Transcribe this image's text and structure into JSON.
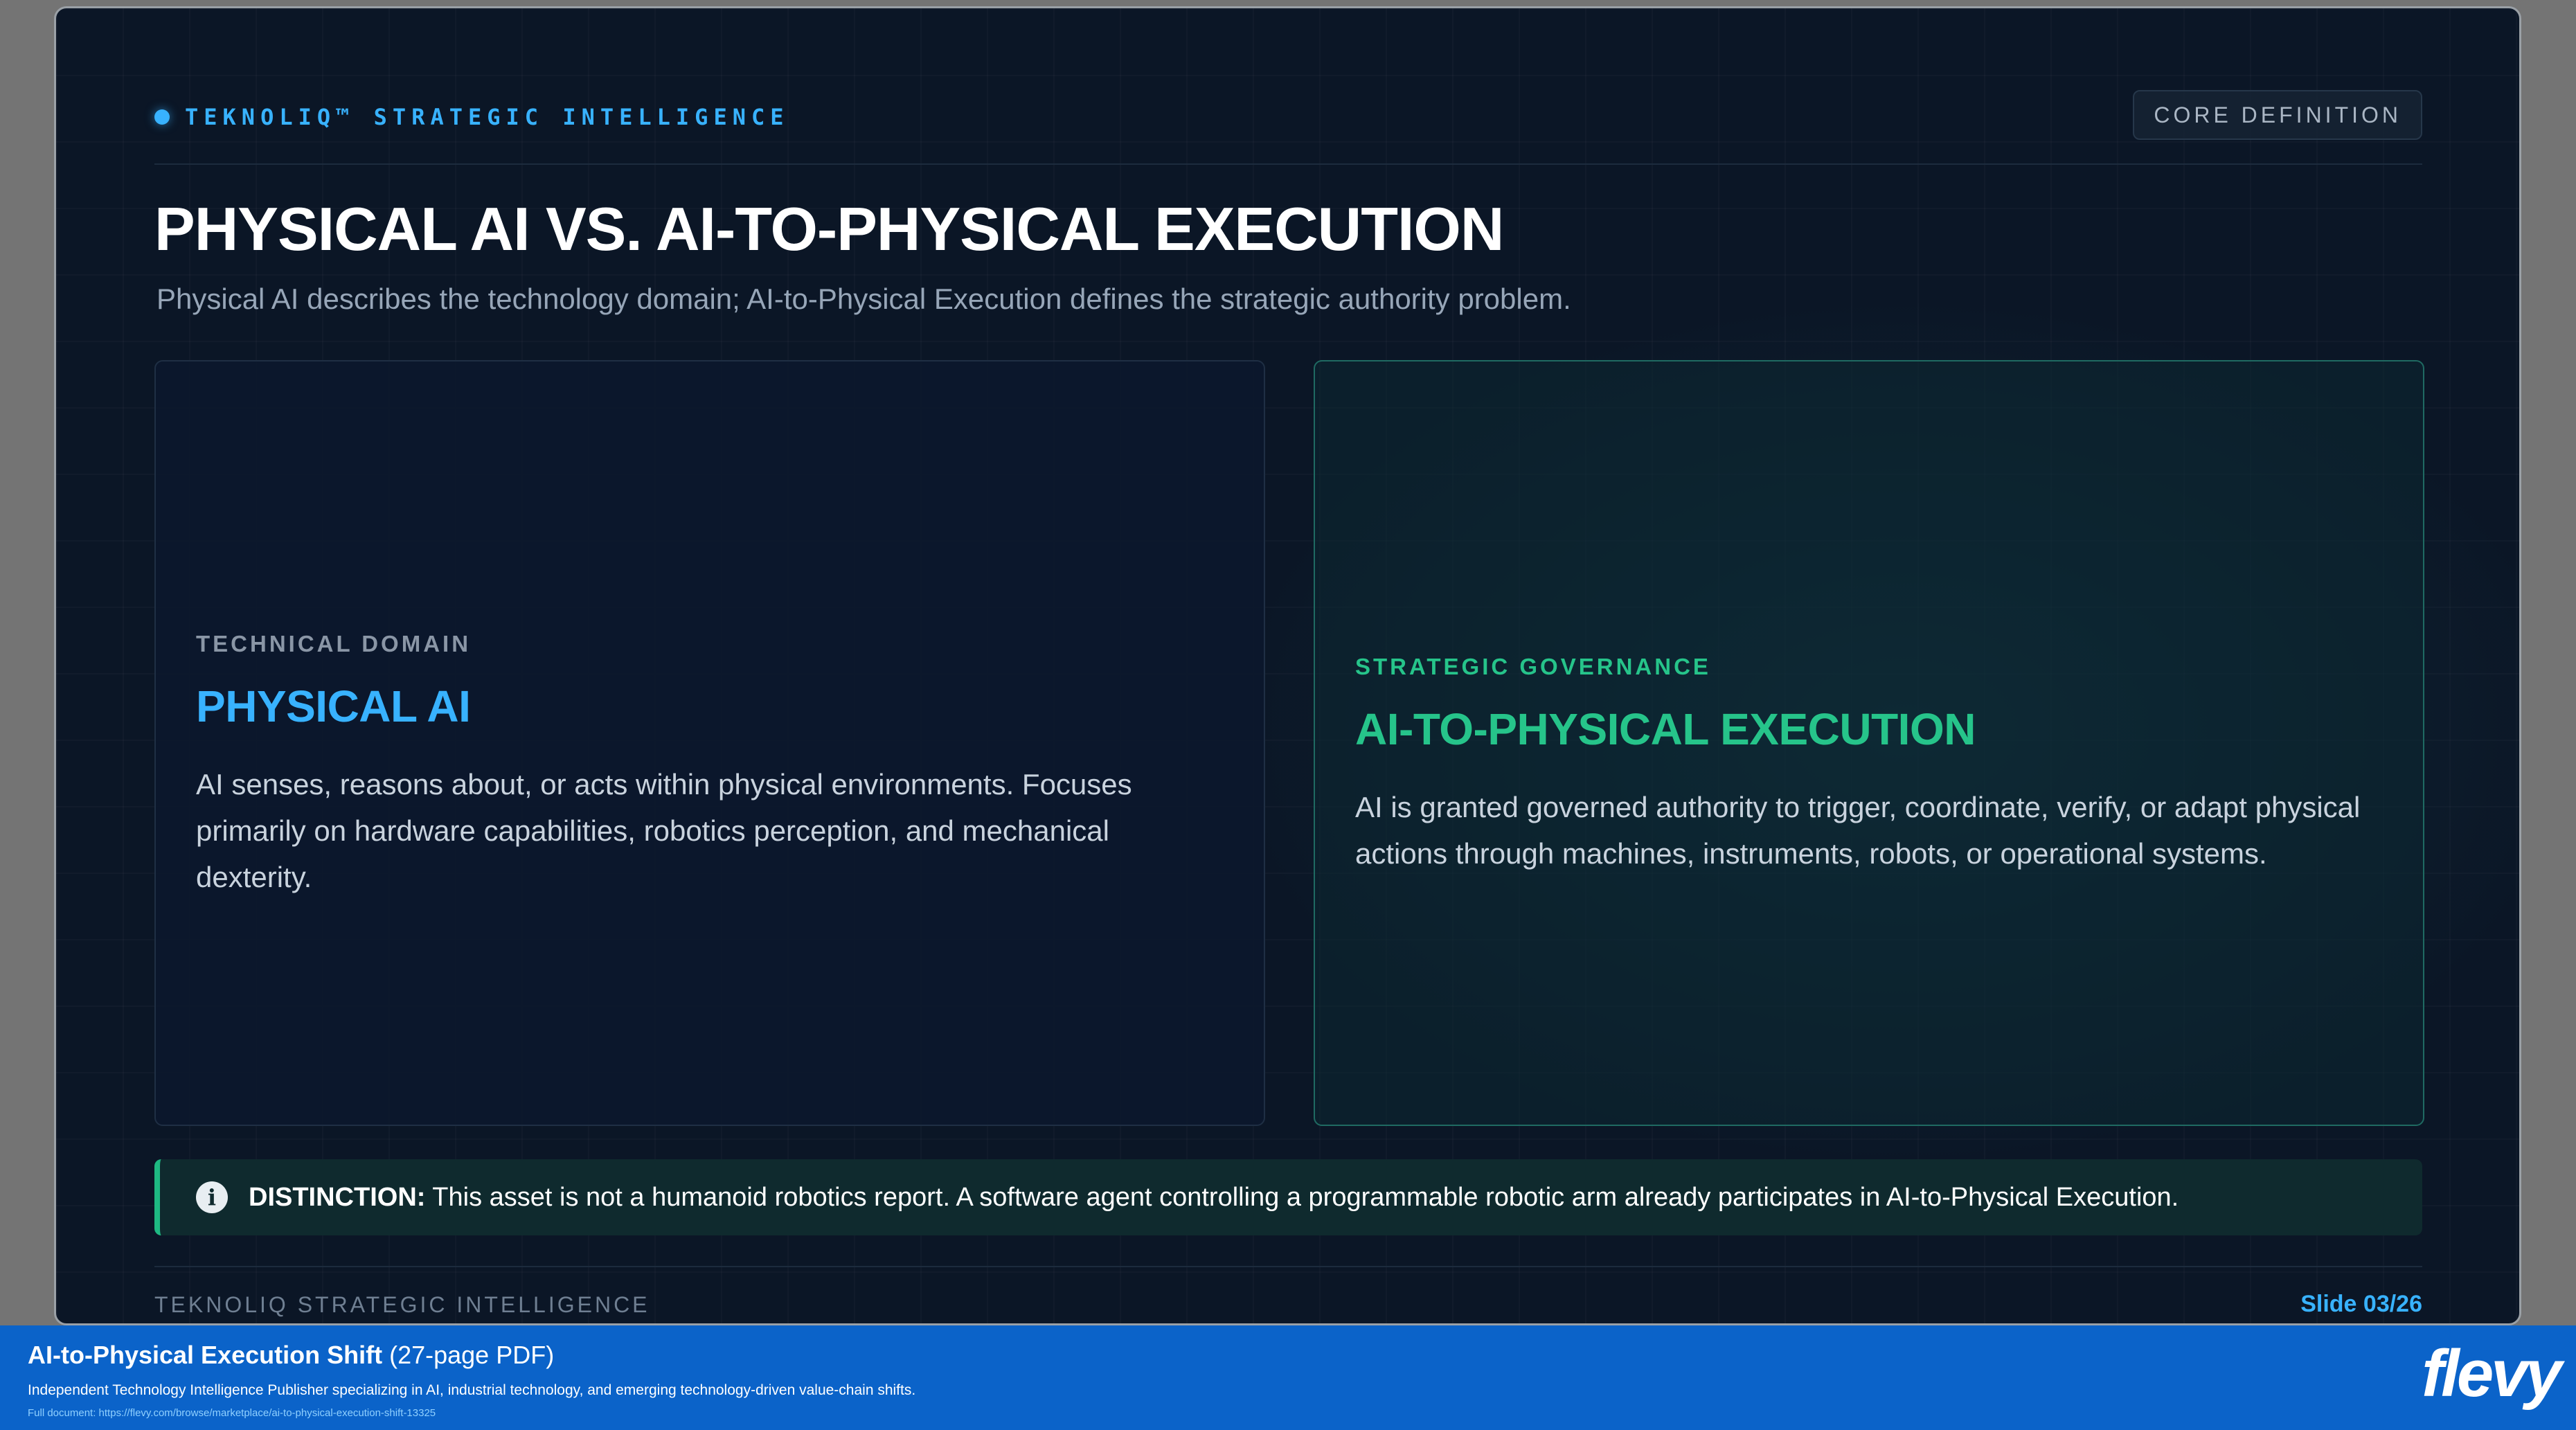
{
  "slide": {
    "brand": "TEKNOLIQ™ STRATEGIC INTELLIGENCE",
    "tag": "CORE DEFINITION",
    "title": "PHYSICAL AI VS. AI-TO-PHYSICAL EXECUTION",
    "subtitle": "Physical AI describes the technology domain; AI-to-Physical Execution defines the strategic authority problem.",
    "cards": [
      {
        "kicker": "TECHNICAL DOMAIN",
        "title": "PHYSICAL AI",
        "body": "AI senses, reasons about, or acts within physical environments. Focuses primarily on hardware capabilities, robotics perception, and mechanical dexterity."
      },
      {
        "kicker": "STRATEGIC GOVERNANCE",
        "title": "AI-TO-PHYSICAL EXECUTION",
        "body": "AI is granted governed authority to trigger, coordinate, verify, or adapt physical actions through machines, instruments, robots, or operational systems."
      }
    ],
    "callout": {
      "label": "DISTINCTION:",
      "text": " This asset is not a humanoid robotics report. A software agent controlling a programmable robotic arm already participates in AI-to-Physical Execution."
    },
    "footer": {
      "left": "TEKNOLIQ STRATEGIC INTELLIGENCE",
      "right": "Slide 03/26"
    }
  },
  "banner": {
    "title": "AI-to-Physical Execution Shift",
    "pages": " (27-page PDF)",
    "description": "Independent Technology Intelligence Publisher specializing in AI, industrial technology, and emerging technology-driven value-chain shifts.",
    "link": "Full document: https://flevy.com/browse/marketplace/ai-to-physical-execution-shift-13325",
    "logo": "flevy"
  },
  "colors": {
    "accent_blue": "#38b2ff",
    "accent_green": "#26c48a",
    "slide_bg": "#0b1626",
    "banner_bg": "#0b63c9"
  },
  "icons": [
    "status-dot-icon",
    "info-icon"
  ]
}
